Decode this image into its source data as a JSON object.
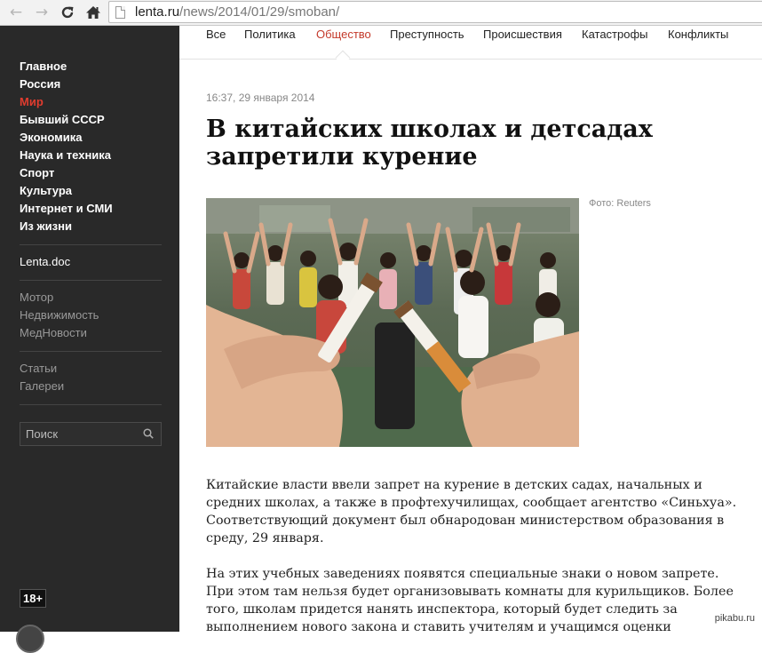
{
  "browser": {
    "url_domain": "lenta.ru",
    "url_path": "/news/2014/01/29/smoban/"
  },
  "topnav": {
    "tabs": [
      "Все",
      "Политика",
      "Общество",
      "Преступность",
      "Происшествия",
      "Катастрофы",
      "Конфликты"
    ],
    "active_tab": "Общество",
    "active_color": "#c43a2b"
  },
  "sidebar": {
    "main_items": [
      "Главное",
      "Россия",
      "Мир",
      "Бывший СССР",
      "Экономика",
      "Наука и техника",
      "Спорт",
      "Культура",
      "Интернет и СМИ",
      "Из жизни"
    ],
    "active_item": "Мир",
    "active_color": "#e03c2f",
    "doc_items": [
      "Lenta.doc"
    ],
    "gray_items_1": [
      "Мотор",
      "Недвижимость",
      "МедНовости"
    ],
    "gray_items_2": [
      "Статьи",
      "Галереи"
    ],
    "search_placeholder": "Поиск",
    "age_rating": "18+"
  },
  "article": {
    "timestamp": "16:37, 29 января 2014",
    "title_line1": "В китайских школах и детсадах",
    "title_line2": "запретили курение",
    "photo_credit": "Фото: Reuters",
    "paragraph1": "Китайские власти ввели запрет на курение в детских садах, начальных и средних школах, а также в профтехучилищах, сообщает агентство «Синьхуа». Соответствующий документ был обнародован министерством образования в среду, 29 января.",
    "paragraph2": "На этих учебных заведениях появятся специальные знаки о новом запрете. При этом там нельзя будет организовывать комнаты для курильщиков. Более того, школам придется нанять инспектора, который будет следить за выполнением нового закона и ставить учителям и учащимся оценки"
  },
  "watermark": "pikabu.ru"
}
